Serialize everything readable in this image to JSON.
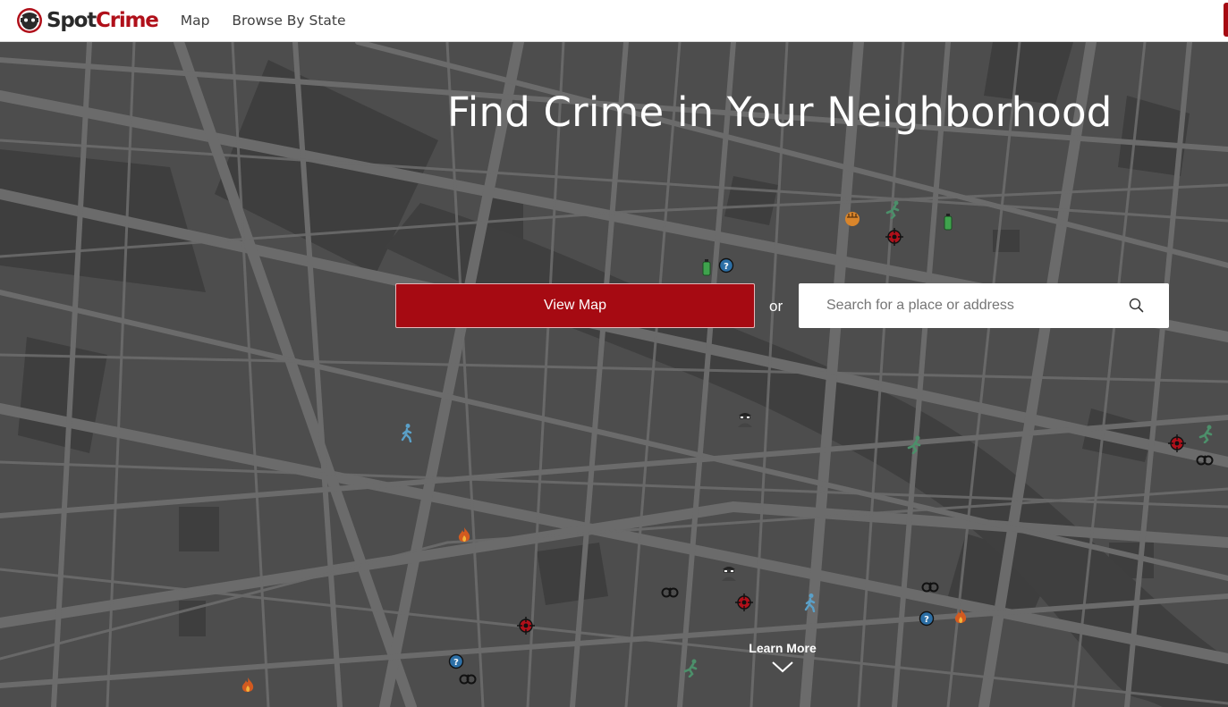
{
  "nav": {
    "brand_spot": "Spot",
    "brand_crime": "Crime",
    "links": [
      {
        "label": "Map"
      },
      {
        "label": "Browse By State"
      }
    ]
  },
  "hero": {
    "title": "Find Crime in Your Neighborhood",
    "view_map_label": "View Map",
    "or_label": "or",
    "search_placeholder": "Search for a place or address",
    "learn_more_label": "Learn More"
  },
  "colors": {
    "brand_red": "#a60a12",
    "map_background": "#4d4d4d",
    "road": "#6b6b6b",
    "block_dark": "#3e3e3e"
  },
  "crime_marker_icons": [
    "assault-icon",
    "robbery-icon",
    "vandalism-icon",
    "shooting-icon",
    "other-icon",
    "theft-icon",
    "burglary-icon",
    "arson-icon",
    "arrest-icon"
  ]
}
